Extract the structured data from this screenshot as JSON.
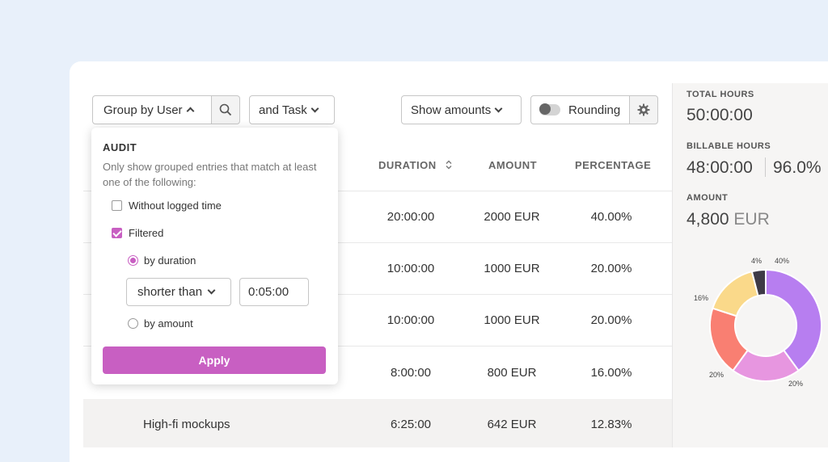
{
  "toolbar": {
    "group_by": "Group by User",
    "task": "and Task",
    "show_amounts": "Show amounts",
    "rounding": "Rounding"
  },
  "table": {
    "headers": {
      "duration": "DURATION",
      "amount": "AMOUNT",
      "percentage": "PERCENTAGE"
    },
    "rows": [
      {
        "name": "",
        "duration": "20:00:00",
        "amount": "2000 EUR",
        "percentage": "40.00%"
      },
      {
        "name": "",
        "duration": "10:00:00",
        "amount": "1000 EUR",
        "percentage": "20.00%"
      },
      {
        "name": "",
        "duration": "10:00:00",
        "amount": "1000 EUR",
        "percentage": "20.00%"
      },
      {
        "name": "",
        "duration": "8:00:00",
        "amount": "800 EUR",
        "percentage": "16.00%"
      },
      {
        "name": "High-fi mockups",
        "duration": "6:25:00",
        "amount": "642 EUR",
        "percentage": "12.83%"
      }
    ]
  },
  "summary": {
    "total_hours_label": "TOTAL HOURS",
    "total_hours": "50:00:00",
    "billable_label": "BILLABLE HOURS",
    "billable_hours": "48:00:00",
    "billable_pct": "96.0%",
    "amount_label": "AMOUNT",
    "amount_value": "4,800",
    "amount_currency": "EUR"
  },
  "donut": {
    "slices": [
      {
        "label": "40%",
        "value": 40,
        "color": "#b77ef0"
      },
      {
        "label": "20%",
        "value": 20,
        "color": "#e796e0"
      },
      {
        "label": "20%",
        "value": 20,
        "color": "#f97f72"
      },
      {
        "label": "16%",
        "value": 16,
        "color": "#fad98a"
      },
      {
        "label": "4%",
        "value": 4,
        "color": "#3e3a46"
      }
    ]
  },
  "audit": {
    "title": "AUDIT",
    "description": "Only show grouped entries that match at least one of the following:",
    "without_logged": "Without logged time",
    "filtered": "Filtered",
    "by_duration": "by duration",
    "comparison": "shorter than",
    "duration_value": "0:05:00",
    "by_amount": "by amount",
    "apply": "Apply"
  }
}
